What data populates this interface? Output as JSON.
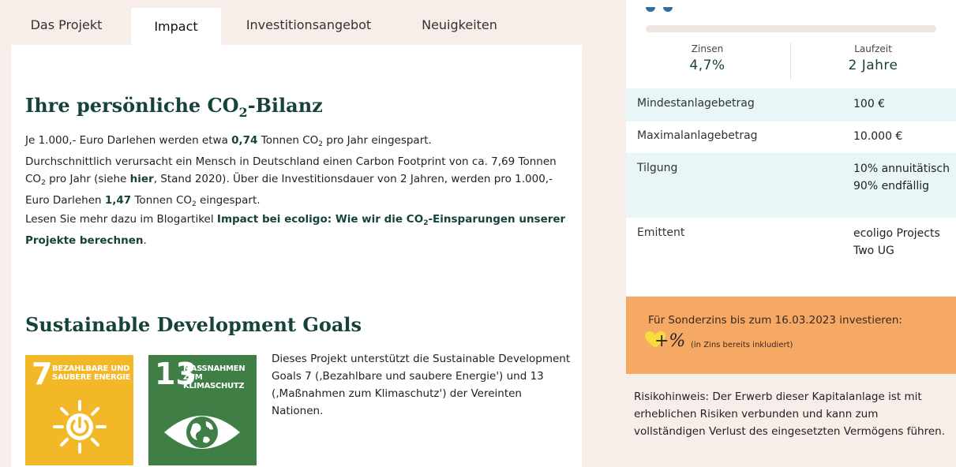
{
  "tabs": [
    {
      "label": "Das Projekt"
    },
    {
      "label": "Impact"
    },
    {
      "label": "Investitionsangebot"
    },
    {
      "label": "Neuigkeiten"
    }
  ],
  "co2": {
    "heading_main": "Ihre persönliche CO",
    "heading_sub": "2",
    "heading_end": "-Bilanz",
    "p1_a": "Je 1.000,- Euro Darlehen werden etwa ",
    "p1_b": "0,74",
    "p1_c": " Tonnen CO",
    "p1_d": "2",
    "p1_e": " pro Jahr eingespart.",
    "p1_f": "Durchschnittlich verursacht ein Mensch in Deutschland einen Carbon Footprint von ca. 7,69 Tonnen CO",
    "p1_g": "2",
    "p1_h": " pro Jahr (siehe ",
    "p1_link": "hier",
    "p1_i": ", Stand 2020). Über die Investitionsdauer von 2 Jahren, werden pro 1.000,- Euro Darlehen ",
    "p1_j": "1,47",
    "p1_k": " Tonnen CO",
    "p1_l": "2",
    "p1_m": " eingespart.",
    "p2_a": "Lesen Sie mehr dazu im Blogartikel ",
    "p2_link_a": "Impact bei ecoligo: Wie wir die CO",
    "p2_link_sub": "2",
    "p2_link_b": "-Einsparungen unserer Projekte berechnen",
    "p2_end": "."
  },
  "sdg": {
    "heading": "Sustainable Development Goals",
    "goal7": {
      "number": "7",
      "title": "BEZAHLBARE UND SAUBERE ENERGIE",
      "color": "#f2b827"
    },
    "goal13": {
      "number": "13",
      "title": "MASSNAHMEN ZUM KLIMASCHUTZ",
      "color": "#3f7e44"
    },
    "text": "Dieses Projekt unterstützt die Sustainable Development Goals 7 (‚Bezahlbare und saubere Energie') und 13 (‚Maßnahmen zum Klimaschutz') der Vereinten Nationen."
  },
  "kpis": [
    {
      "label": "Zinsen",
      "value": "4,7%"
    },
    {
      "label": "Laufzeit",
      "value": "2 Jahre"
    }
  ],
  "details": [
    {
      "key": "Mindestanlagebetrag",
      "value": "100 €"
    },
    {
      "key": "Maximalanlagebetrag",
      "value": "10.000 €"
    },
    {
      "key": "Tilgung",
      "value": "10% annuitätisch 90% endfällig"
    },
    {
      "key": "Emittent",
      "value": "ecoligo Projects Two UG"
    }
  ],
  "promo": {
    "line1": "Für Sonderzins bis zum 16.03.2023 investieren:",
    "badge": "+%",
    "note": "(in Zins bereits inkludiert)",
    "background": "#f6a865"
  },
  "risk": "Risikohinweis: Der Erwerb dieser Kapitalanlage ist mit erheblichen Risiken verbunden und kann zum vollständigen Verlust des eingesetzten Vermögens führen.",
  "colors": {
    "heading": "#16423c",
    "accent_blue": "#2e6fa3",
    "row_alt": "#e9f6f7"
  }
}
